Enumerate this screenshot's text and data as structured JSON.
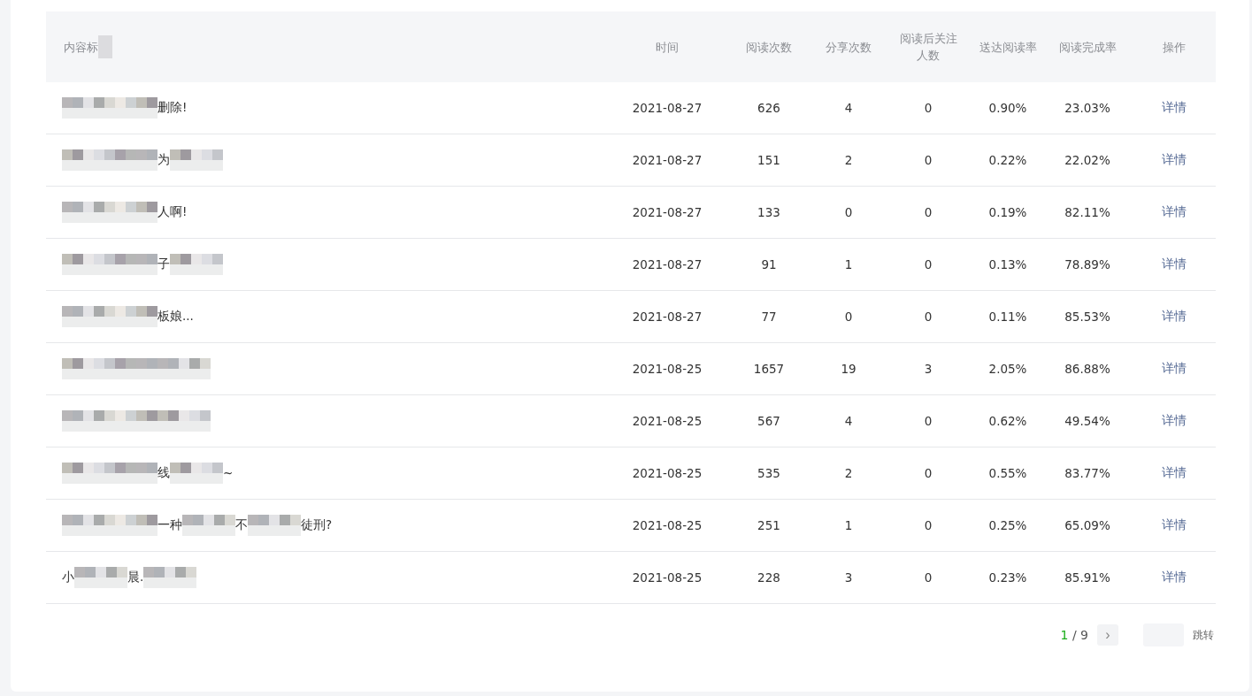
{
  "table": {
    "columns": [
      {
        "parts": [
          {
            "kind": "text",
            "text": "内容标"
          },
          {
            "kind": "mosaic"
          }
        ]
      },
      {
        "label": "时间"
      },
      {
        "label": "阅读次数"
      },
      {
        "label": "分享次数"
      },
      {
        "label": "阅读后关注人数"
      },
      {
        "label": "送达阅读率"
      },
      {
        "label": "阅读完成率"
      },
      {
        "label": "操作"
      }
    ],
    "rows": [
      {
        "cells": [
          {
            "parts": [
              {
                "kind": "mosaic"
              },
              {
                "kind": "text",
                "text": "删除!"
              }
            ]
          },
          "2021-08-27",
          "626",
          "4",
          "0",
          "0.90%",
          "23.03%",
          "详情"
        ]
      },
      {
        "cells": [
          {
            "parts": [
              {
                "kind": "mosaic"
              },
              {
                "kind": "text",
                "text": "为"
              },
              {
                "kind": "mosaic"
              }
            ]
          },
          "2021-08-27",
          "151",
          "2",
          "0",
          "0.22%",
          "22.02%",
          "详情"
        ]
      },
      {
        "cells": [
          {
            "parts": [
              {
                "kind": "mosaic"
              },
              {
                "kind": "text",
                "text": "人啊!"
              }
            ]
          },
          "2021-08-27",
          "133",
          "0",
          "0",
          "0.19%",
          "82.11%",
          "详情"
        ]
      },
      {
        "cells": [
          {
            "parts": [
              {
                "kind": "mosaic"
              },
              {
                "kind": "text",
                "text": "子"
              },
              {
                "kind": "mosaic"
              }
            ]
          },
          "2021-08-27",
          "91",
          "1",
          "0",
          "0.13%",
          "78.89%",
          "详情"
        ]
      },
      {
        "cells": [
          {
            "parts": [
              {
                "kind": "mosaic"
              },
              {
                "kind": "text",
                "text": "板娘..."
              }
            ]
          },
          "2021-08-27",
          "77",
          "0",
          "0",
          "0.11%",
          "85.53%",
          "详情"
        ]
      },
      {
        "cells": [
          {
            "parts": [
              {
                "kind": "mosaic"
              },
              {
                "kind": "mosaic"
              }
            ]
          },
          "2021-08-25",
          "1657",
          "19",
          "3",
          "2.05%",
          "86.88%",
          "详情"
        ]
      },
      {
        "cells": [
          {
            "parts": [
              {
                "kind": "mosaic"
              },
              {
                "kind": "mosaic"
              }
            ]
          },
          "2021-08-25",
          "567",
          "4",
          "0",
          "0.62%",
          "49.54%",
          "详情"
        ]
      },
      {
        "cells": [
          {
            "parts": [
              {
                "kind": "mosaic"
              },
              {
                "kind": "text",
                "text": "线"
              },
              {
                "kind": "mosaic"
              },
              {
                "kind": "text",
                "text": "~"
              }
            ]
          },
          "2021-08-25",
          "535",
          "2",
          "0",
          "0.55%",
          "83.77%",
          "详情"
        ]
      },
      {
        "cells": [
          {
            "parts": [
              {
                "kind": "mosaic"
              },
              {
                "kind": "text",
                "text": "一种"
              },
              {
                "kind": "mosaic"
              },
              {
                "kind": "text",
                "text": "不"
              },
              {
                "kind": "mosaic"
              },
              {
                "kind": "text",
                "text": "徒刑?"
              }
            ]
          },
          "2021-08-25",
          "251",
          "1",
          "0",
          "0.25%",
          "65.09%",
          "详情"
        ]
      },
      {
        "cells": [
          {
            "parts": [
              {
                "kind": "text",
                "text": "小"
              },
              {
                "kind": "mosaic"
              },
              {
                "kind": "text",
                "text": "晨."
              },
              {
                "kind": "mosaic"
              }
            ]
          },
          "2021-08-25",
          "228",
          "3",
          "0",
          "0.23%",
          "85.91%",
          "详情"
        ]
      }
    ]
  },
  "pagination": {
    "current": "1",
    "separator": "/",
    "total": "9",
    "next": "›",
    "jump": "跳转"
  }
}
